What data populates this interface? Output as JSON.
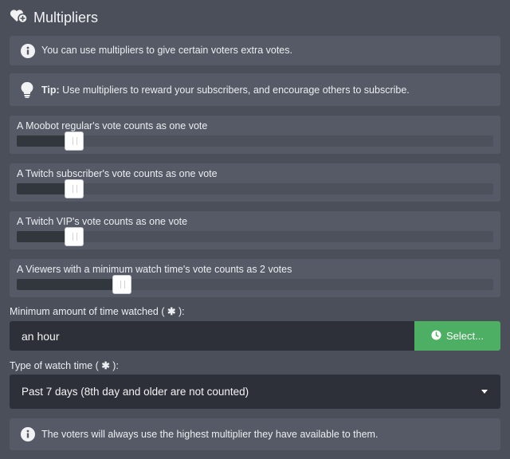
{
  "header": {
    "title": "Multipliers",
    "icon": "hearts-plus-icon"
  },
  "info_top": {
    "text": "You can use multipliers to give certain voters extra votes.",
    "icon": "info-icon"
  },
  "tip": {
    "label": "Tip:",
    "text": " Use multipliers to reward your subscribers, and encourage others to subscribe.",
    "icon": "lightbulb-icon"
  },
  "sliders": [
    {
      "label": "A Moobot regular's vote counts as one vote",
      "level": 1
    },
    {
      "label": "A Twitch subscriber's vote counts as one vote",
      "level": 1
    },
    {
      "label": "A Twitch VIP's vote counts as one vote",
      "level": 1
    },
    {
      "label": "A Viewers with a minimum watch time's vote counts as 2 votes",
      "level": 2
    }
  ],
  "watch_time": {
    "label": "Minimum amount of time watched ( ",
    "star": "✱",
    "label_end": " ):",
    "value": "an hour",
    "button_label": "Select...",
    "button_icon": "clock-icon"
  },
  "watch_type": {
    "label": "Type of watch time ( ",
    "star": "✱",
    "label_end": " ):",
    "selected": "Past 7 days (8th day and older are not counted)"
  },
  "info_bottom": {
    "text": "The voters will always use the highest multiplier they have available to them.",
    "icon": "info-icon"
  },
  "colors": {
    "background": "#4a4f5a",
    "panel": "#555a66",
    "input": "#2d3038",
    "accent_green": "#4caf63"
  }
}
